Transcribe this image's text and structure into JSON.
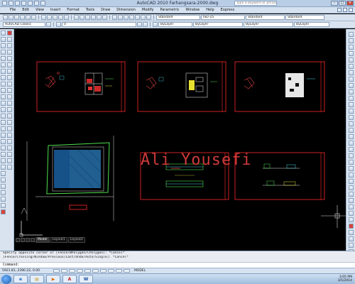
{
  "window": {
    "title": "AutoCAD 2010   Farhangsara-2000.dwg",
    "search_placeholder": "Type a keyword or phrase"
  },
  "menubar": {
    "items": [
      "File",
      "Edit",
      "View",
      "Insert",
      "Format",
      "Tools",
      "Draw",
      "Dimension",
      "Modify",
      "Parametric",
      "Window",
      "Help",
      "Express"
    ]
  },
  "toolbar": {
    "workspace": "AutoCAD Classic",
    "layer": "0",
    "text_style": "Standard",
    "dim_style": "ISO-25",
    "color_control": "ByLayer",
    "linetype_control": "ByLayer",
    "lineweight_control": "ByLayer"
  },
  "drawing": {
    "watermark": "Ali_Yousefi"
  },
  "layout_tabs": [
    "Model",
    "Layout1",
    "Layout2"
  ],
  "command": {
    "history": [
      "Specify opposite corner or [Fence/WPolygon/CPolygon]: *Cancel*",
      "[Fence/Crossing/Window/Previous/Last/Undo/Auto/Single]: *Cancel*"
    ],
    "prompt": "Command:"
  },
  "statusbar": {
    "coords": "5921.81, 2390.22, 0.00",
    "model_label": "MODEL"
  },
  "taskbar": {
    "apps": [
      "ie",
      "explorer",
      "media",
      "acad",
      "word"
    ],
    "time": "3:05 PM",
    "date": "3/5/2014"
  },
  "colors": {
    "canvas_bg": "#000000",
    "sheet_border": "#ff2a2a",
    "watermark": "#cf3a3a",
    "ui_chrome": "#d8e3ef"
  }
}
